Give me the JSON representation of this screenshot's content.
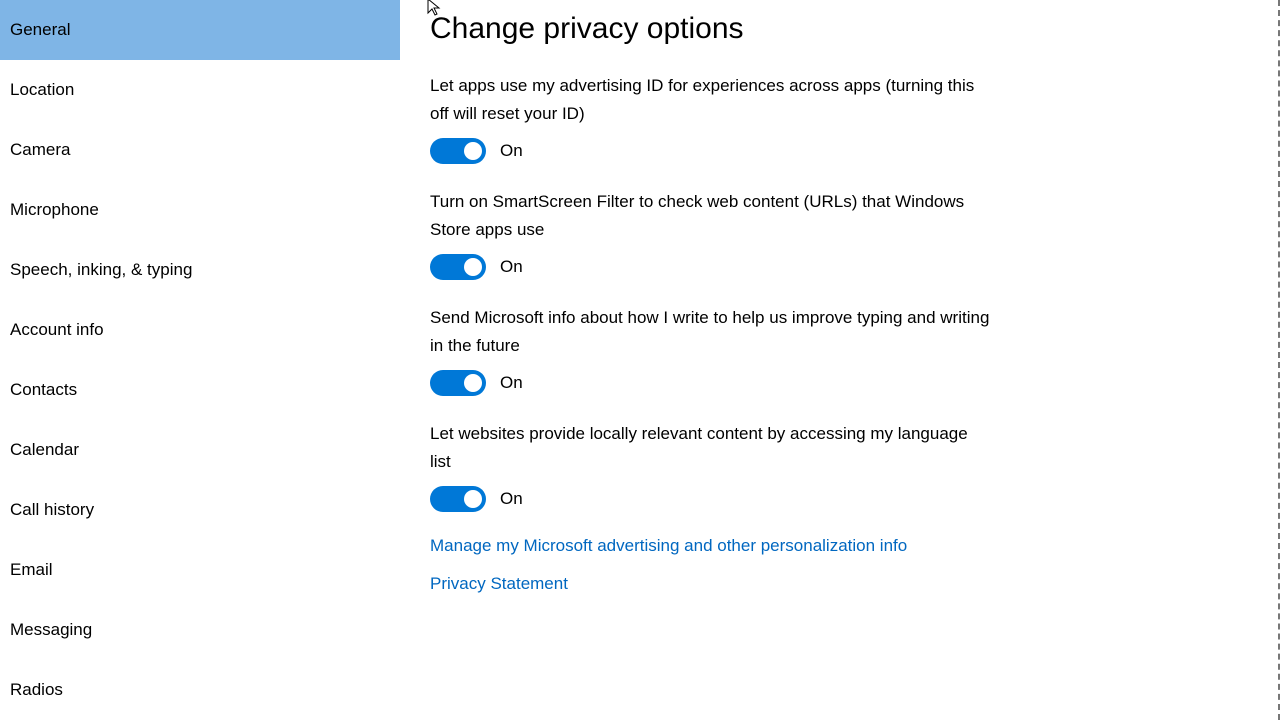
{
  "sidebar": {
    "items": [
      {
        "label": "General",
        "selected": true
      },
      {
        "label": "Location",
        "selected": false
      },
      {
        "label": "Camera",
        "selected": false
      },
      {
        "label": "Microphone",
        "selected": false
      },
      {
        "label": "Speech, inking, & typing",
        "selected": false
      },
      {
        "label": "Account info",
        "selected": false
      },
      {
        "label": "Contacts",
        "selected": false
      },
      {
        "label": "Calendar",
        "selected": false
      },
      {
        "label": "Call history",
        "selected": false
      },
      {
        "label": "Email",
        "selected": false
      },
      {
        "label": "Messaging",
        "selected": false
      },
      {
        "label": "Radios",
        "selected": false
      }
    ]
  },
  "main": {
    "heading": "Change privacy options",
    "options": [
      {
        "desc": "Let apps use my advertising ID for experiences across apps (turning this off will reset your ID)",
        "state": "On"
      },
      {
        "desc": "Turn on SmartScreen Filter to check web content (URLs) that Windows Store apps use",
        "state": "On"
      },
      {
        "desc": "Send Microsoft info about how I write to help us improve typing and writing in the future",
        "state": "On"
      },
      {
        "desc": "Let websites provide locally relevant content by accessing my language list",
        "state": "On"
      }
    ],
    "links": [
      "Manage my Microsoft advertising and other personalization info",
      "Privacy Statement"
    ]
  }
}
